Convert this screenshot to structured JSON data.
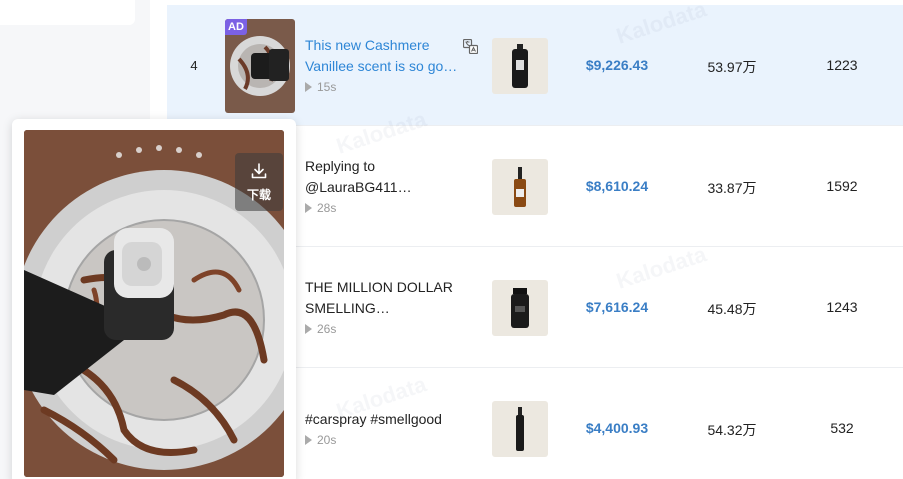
{
  "watermark": "Kalodata",
  "rows": [
    {
      "rank": "4",
      "ad_badge": "AD",
      "title_line1": "This new Cashmere",
      "title_line2": "Vanillee scent is so go…",
      "duration": "15s",
      "revenue": "$9,226.43",
      "views": "53.97万",
      "likes": "1223",
      "highlighted": true
    },
    {
      "title_line1": "Replying to",
      "title_line2": "@LauraBG411…",
      "duration": "28s",
      "revenue": "$8,610.24",
      "views": "33.87万",
      "likes": "1592"
    },
    {
      "title_line1": "THE MILLION DOLLAR",
      "title_line2": "SMELLING…",
      "duration": "26s",
      "revenue": "$7,616.24",
      "views": "45.48万",
      "likes": "1243"
    },
    {
      "title_line1": "#carspray #smellgood",
      "duration": "20s",
      "revenue": "$4,400.93",
      "views": "54.32万",
      "likes": "532"
    }
  ],
  "popup": {
    "download_label": "下载"
  },
  "colors": {
    "link": "#2e86d6",
    "revenue": "#3a7ec5",
    "highlight_row": "#eaf3fd",
    "ad_badge": "#7b61e4"
  }
}
